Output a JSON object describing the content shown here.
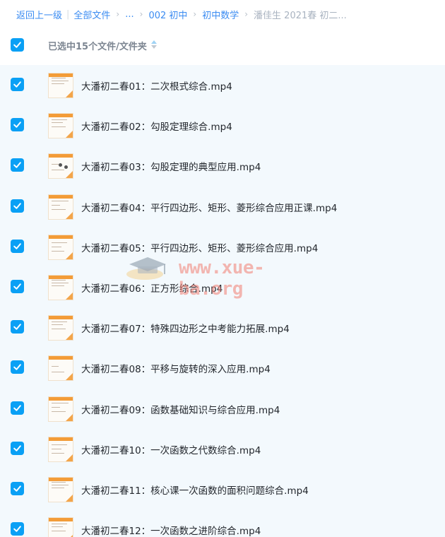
{
  "breadcrumb": {
    "back": "返回上一级",
    "all_files": "全部文件",
    "ellipsis": "...",
    "level1": "002 初中",
    "level2": "初中数学",
    "current": "潘佳生 2021春 初二..."
  },
  "selection": {
    "label": "已选中15个文件/文件夹",
    "all_checked": true
  },
  "watermark": {
    "text": "www.xue-ba.org"
  },
  "colors": {
    "accent": "#0aa0f5",
    "link": "#3b8cf2",
    "list_bg": "#f3f9fd",
    "thumb_accent": "#f39c38"
  },
  "files": [
    {
      "name": "大潘初二春01：二次根式综合.mp4",
      "checked": true,
      "icon": "video-thumbnail"
    },
    {
      "name": "大潘初二春02：勾股定理综合.mp4",
      "checked": true,
      "icon": "video-thumbnail"
    },
    {
      "name": "大潘初二春03：勾股定理的典型应用.mp4",
      "checked": true,
      "icon": "video-thumbnail"
    },
    {
      "name": "大潘初二春04：平行四边形、矩形、菱形综合应用正课.mp4",
      "checked": true,
      "icon": "video-thumbnail"
    },
    {
      "name": "大潘初二春05：平行四边形、矩形、菱形综合应用.mp4",
      "checked": true,
      "icon": "video-thumbnail"
    },
    {
      "name": "大潘初二春06：正方形综合.mp4",
      "checked": true,
      "icon": "video-thumbnail"
    },
    {
      "name": "大潘初二春07：特殊四边形之中考能力拓展.mp4",
      "checked": true,
      "icon": "video-thumbnail"
    },
    {
      "name": "大潘初二春08：平移与旋转的深入应用.mp4",
      "checked": true,
      "icon": "video-thumbnail"
    },
    {
      "name": "大潘初二春09：函数基础知识与综合应用.mp4",
      "checked": true,
      "icon": "video-thumbnail"
    },
    {
      "name": "大潘初二春10：一次函数之代数综合.mp4",
      "checked": true,
      "icon": "video-thumbnail"
    },
    {
      "name": "大潘初二春11：核心课一次函数的面积问题综合.mp4",
      "checked": true,
      "icon": "video-thumbnail"
    },
    {
      "name": "大潘初二春12：一次函数之进阶综合.mp4",
      "checked": true,
      "icon": "video-thumbnail"
    }
  ]
}
